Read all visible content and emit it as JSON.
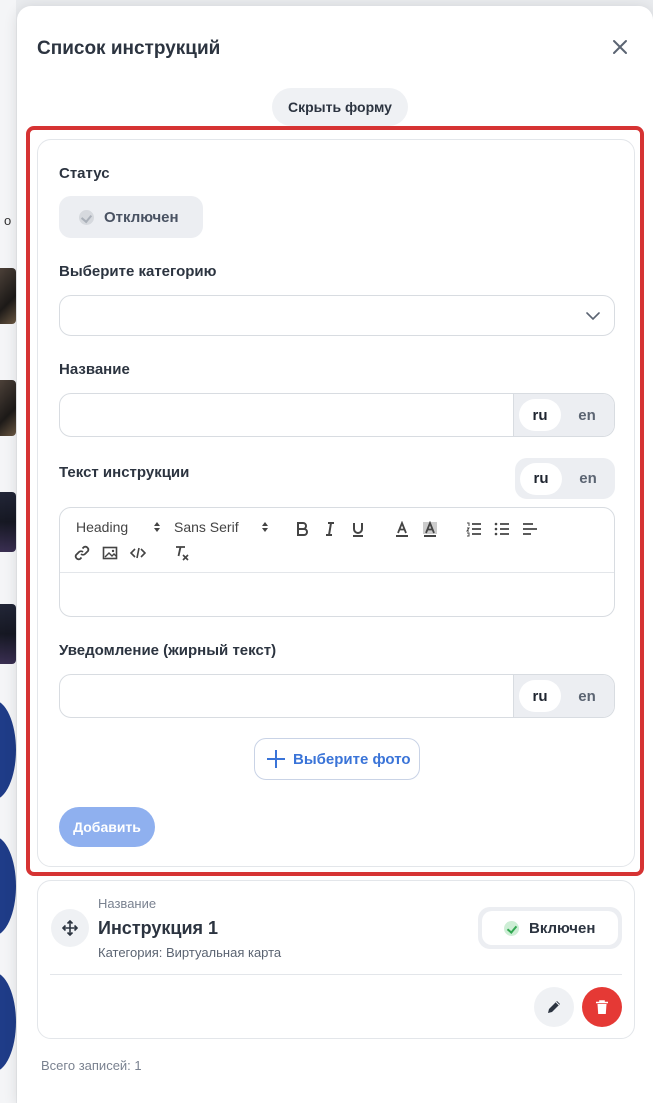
{
  "background": {
    "partial_letter": "о"
  },
  "modal": {
    "title": "Список инструкций",
    "hide_form_label": "Скрыть форму"
  },
  "form": {
    "status_label": "Статус",
    "status_value": "Отключен",
    "category_label": "Выберите категорию",
    "category_value": "",
    "name_label": "Название",
    "name_value": "",
    "text_label": "Текст инструкции",
    "notice_label": "Уведомление (жирный текст)",
    "notice_value": "",
    "langs": [
      "ru",
      "en"
    ],
    "active_lang": "ru",
    "editor": {
      "heading_select": "Heading",
      "font_select": "Sans Serif",
      "body_text": ""
    },
    "add_photo_label": "Выберите фото",
    "submit_label": "Добавить"
  },
  "list": {
    "items": [
      {
        "label": "Название",
        "title": "Инструкция 1",
        "category": "Категория: Виртуальная карта",
        "status": "Включен"
      }
    ],
    "total": "Всего записей: 1"
  },
  "colors": {
    "accent": "#3a74d8",
    "highlight_border": "#d63333",
    "delete": "#e53935",
    "submit_disabled": "#8fb0ef",
    "active_status": "#32a852"
  }
}
